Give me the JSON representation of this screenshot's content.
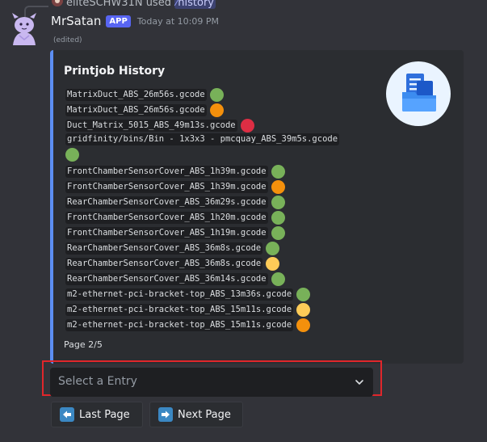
{
  "reply": {
    "user": "eliteSCHW31N",
    "used": "used",
    "command": "history"
  },
  "message": {
    "author": "MrSatan",
    "badge": "APP",
    "timestamp": "Today at 10:09 PM",
    "edited": "(edited)"
  },
  "embed": {
    "accent_color": "#5c8ef2",
    "title": "Printjob History",
    "thumbnail_icon": "folder-documents-icon",
    "footer": "Page 2/5",
    "jobs": [
      {
        "file": "MatrixDuct_ABS_26m56s.gcode",
        "status": "green"
      },
      {
        "file": "MatrixDuct_ABS_26m56s.gcode",
        "status": "orange"
      },
      {
        "file": "Duct_Matrix_5015_ABS_49m13s.gcode",
        "status": "red"
      },
      {
        "file": "gridfinity/bins/Bin - 1x3x3 - pmcquay_ABS_39m5s.gcode",
        "status": "green"
      },
      {
        "file": "FrontChamberSensorCover_ABS_1h39m.gcode",
        "status": "green"
      },
      {
        "file": "FrontChamberSensorCover_ABS_1h39m.gcode",
        "status": "orange"
      },
      {
        "file": "RearChamberSensorCover_ABS_36m29s.gcode",
        "status": "green"
      },
      {
        "file": "FrontChamberSensorCover_ABS_1h20m.gcode",
        "status": "green"
      },
      {
        "file": "FrontChamberSensorCover_ABS_1h19m.gcode",
        "status": "green"
      },
      {
        "file": "RearChamberSensorCover_ABS_36m8s.gcode",
        "status": "green"
      },
      {
        "file": "RearChamberSensorCover_ABS_36m8s.gcode",
        "status": "yellow"
      },
      {
        "file": "RearChamberSensorCover_ABS_36m14s.gcode",
        "status": "green"
      },
      {
        "file": "m2-ethernet-pci-bracket-top_ABS_13m36s.gcode",
        "status": "green"
      },
      {
        "file": "m2-ethernet-pci-bracket-top_ABS_15m11s.gcode",
        "status": "yellow"
      },
      {
        "file": "m2-ethernet-pci-bracket-top_ABS_15m11s.gcode",
        "status": "orange"
      }
    ]
  },
  "status_colors": {
    "green": "#78b159",
    "orange": "#f4900c",
    "red": "#dd2e44",
    "yellow": "#fdcb58"
  },
  "select": {
    "placeholder": "Select a Entry",
    "icon": "chevron-down-icon"
  },
  "buttons": {
    "last_page": {
      "label": "Last Page",
      "icon": "arrow-left-icon"
    },
    "next_page": {
      "label": "Next Page",
      "icon": "arrow-right-icon"
    }
  },
  "highlight_color": "#e0262b"
}
